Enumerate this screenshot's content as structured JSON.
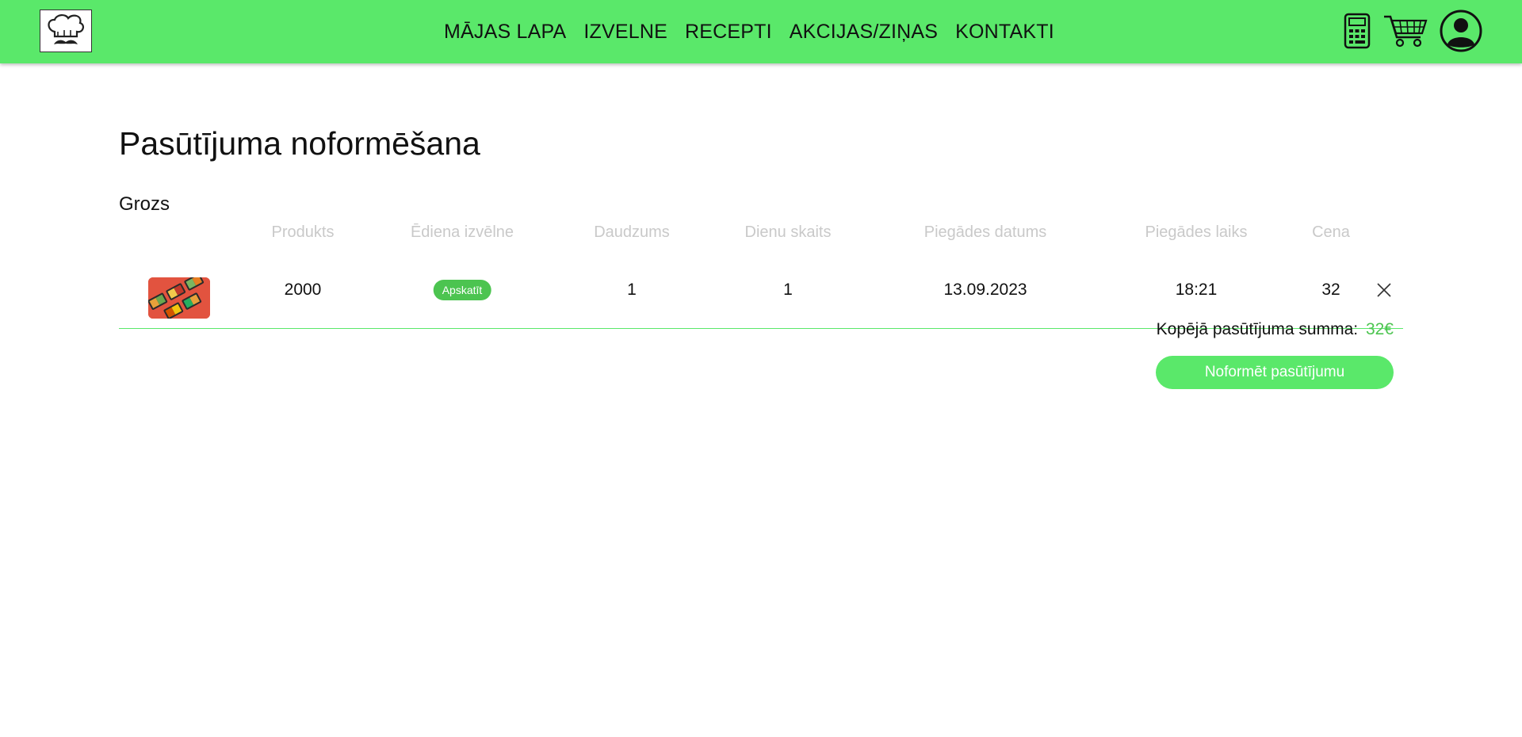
{
  "nav": {
    "items": [
      {
        "label": "MĀJAS LAPA"
      },
      {
        "label": "IZVELNE"
      },
      {
        "label": "RECEPTI"
      },
      {
        "label": "AKCIJAS/ZIŅAS"
      },
      {
        "label": "KONTAKTI"
      }
    ]
  },
  "header_icons": [
    "calculator-icon",
    "cart-icon",
    "user-icon"
  ],
  "page": {
    "title": "Pasūtījuma noformēšana",
    "cart_heading": "Grozs"
  },
  "table": {
    "columns": [
      "Produkts",
      "Ēdiena izvēlne",
      "Daudzums",
      "Dienu skaits",
      "Piegādes datums",
      "Piegādes laiks",
      "Cena"
    ],
    "rows": [
      {
        "product": "2000",
        "menu_button": "Apskatīt",
        "quantity": "1",
        "days": "1",
        "delivery_date": "13.09.2023",
        "delivery_time": "18:21",
        "price": "32"
      }
    ]
  },
  "summary": {
    "label": "Kopējā pasūtījuma summa:",
    "amount": "32€"
  },
  "submit_label": "Noformēt pasūtījumu",
  "colors": {
    "accent": "#5ae86a",
    "accent_dark": "#4cc450",
    "header_text": "#c9c9c9"
  }
}
